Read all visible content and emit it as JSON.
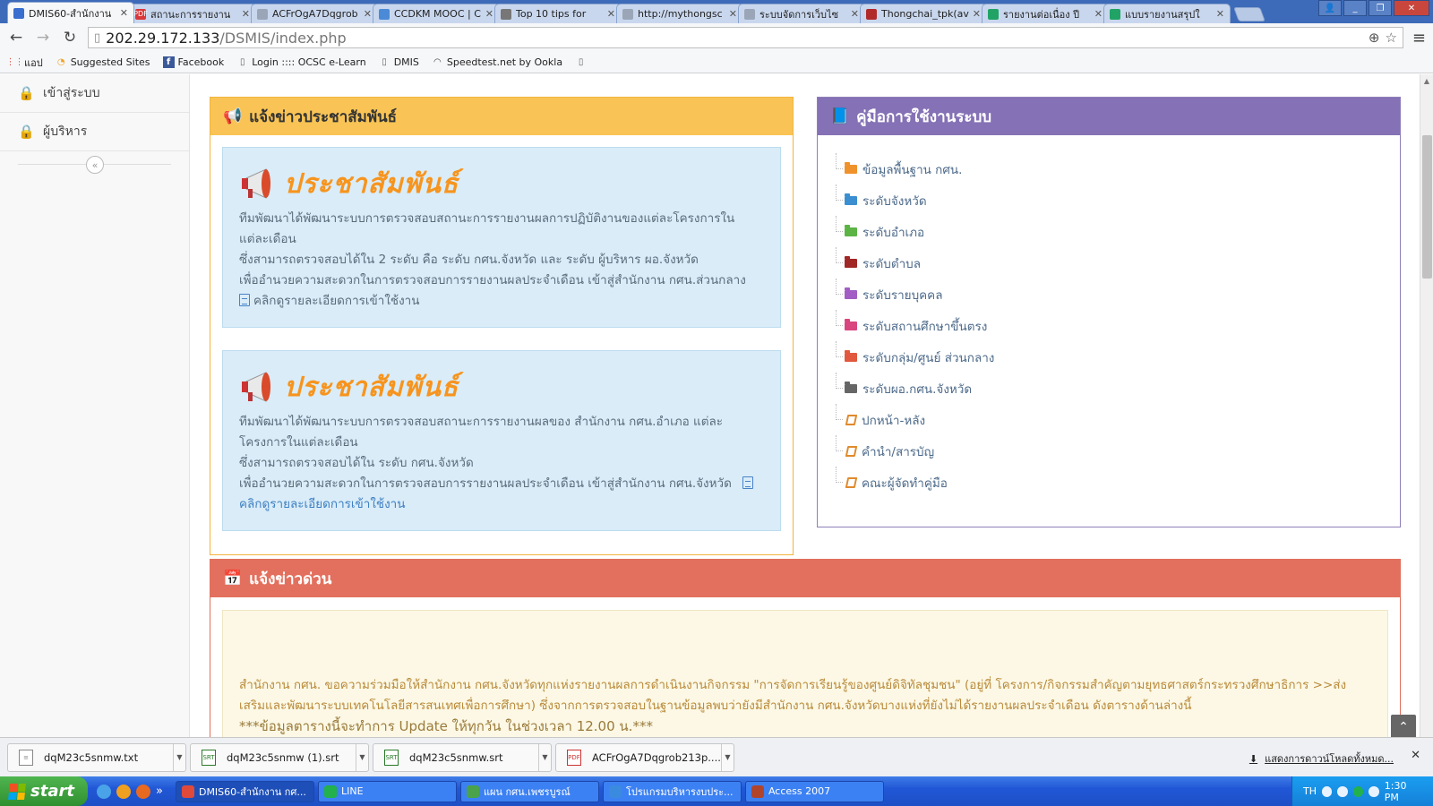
{
  "browser": {
    "tabs": [
      {
        "title": "DMIS60-สำนักงาน",
        "active": true,
        "favicon_color": "#3a6fcf"
      },
      {
        "title": "สถานะการรายงาน",
        "active": false,
        "favicon_color": "#d9383a",
        "favicon_text": "PDF"
      },
      {
        "title": "ACFrOgA7Dqgrob",
        "active": false,
        "favicon_color": "#9aa6b8"
      },
      {
        "title": "CCDKM MOOC | C",
        "active": false,
        "favicon_color": "#4b8ad6"
      },
      {
        "title": "Top 10 tips for",
        "active": false,
        "favicon_color": "#777777"
      },
      {
        "title": "http://mythongsc",
        "active": false,
        "favicon_color": "#9aa6b8"
      },
      {
        "title": "ระบบจัดการเว็บไซ",
        "active": false,
        "favicon_color": "#9aa6b8"
      },
      {
        "title": "Thongchai_tpk(av",
        "active": false,
        "favicon_color": "#b12a2a"
      },
      {
        "title": "รายงานต่อเนื่อง ปี",
        "active": false,
        "favicon_color": "#21a366"
      },
      {
        "title": "แบบรายงานสรุปใ",
        "active": false,
        "favicon_color": "#21a366"
      }
    ],
    "url_host": "202.29.172.133",
    "url_path": "/DSMIS/index.php",
    "bookmarks": [
      {
        "label": "แอป",
        "icon": "apps-icon"
      },
      {
        "label": "Suggested Sites",
        "icon": "suggested-sites-icon"
      },
      {
        "label": "Facebook",
        "icon": "facebook-icon"
      },
      {
        "label": "Login :::: OCSC e-Learn",
        "icon": "page-icon"
      },
      {
        "label": "DMIS",
        "icon": "page-icon"
      },
      {
        "label": "Speedtest.net by Ookla",
        "icon": "speedtest-icon"
      },
      {
        "label": "",
        "icon": "page-icon"
      }
    ]
  },
  "sidebar": {
    "items": [
      {
        "label": "เข้าสู่ระบบ",
        "icon": "lock-icon"
      },
      {
        "label": "ผู้บริหาร",
        "icon": "lock-icon"
      }
    ],
    "collapse_glyph": "«"
  },
  "pr_panel": {
    "title": "แจ้งข่าวประชาสัมพันธ์",
    "banner_text": "ประชาสัมพันธ์",
    "box1": {
      "line1": "ทีมพัฒนาได้พัฒนาระบบการตรวจสอบสถานะการรายงานผลการปฏิบัติงานของแต่ละโครงการใน",
      "line2": "แต่ละเดือน",
      "line3": "ซึ่งสามารถตรวจสอบได้ใน 2 ระดับ คือ ระดับ กศน.จังหวัด และ ระดับ ผู้บริหาร ผอ.จังหวัด",
      "line4": "เพื่ออำนวยความสะดวกในการตรวจสอบการรายงานผลประจำเดือน เข้าสู่สำนักงาน กศน.ส่วนกลาง",
      "link": "คลิกดูรายละเอียดการเข้าใช้งาน"
    },
    "box2": {
      "line1": "ทีมพัฒนาได้พัฒนาระบบการตรวจสอบสถานะการรายงานผลของ สำนักงาน กศน.อำเภอ แต่ละ",
      "line2": "โครงการในแต่ละเดือน",
      "line3": "ซึ่งสามารถตรวจสอบได้ใน ระดับ กศน.จังหวัด",
      "line4": "เพื่ออำนวยความสะดวกในการตรวจสอบการรายงานผลประจำเดือน เข้าสู่สำนักงาน กศน.จังหวัด",
      "link": "คลิกดูรายละเอียดการเข้าใช้งาน"
    }
  },
  "manual_panel": {
    "title": "คู่มือการใช้งานระบบ",
    "items": [
      {
        "label": "ข้อมูลพื้นฐาน กศน.",
        "icon": "folder-icon",
        "color": "#f0922b"
      },
      {
        "label": "ระดับจังหวัด",
        "icon": "folder-icon",
        "color": "#3b8fd0"
      },
      {
        "label": "ระดับอำเภอ",
        "icon": "folder-icon",
        "color": "#5cb445"
      },
      {
        "label": "ระดับตำบล",
        "icon": "folder-icon",
        "color": "#a12626"
      },
      {
        "label": "ระดับรายบุคคล",
        "icon": "folder-icon",
        "color": "#a25ec4"
      },
      {
        "label": "ระดับสถานศึกษาขึ้นตรง",
        "icon": "folder-icon",
        "color": "#d9457e"
      },
      {
        "label": "ระดับกลุ่ม/ศูนย์ ส่วนกลาง",
        "icon": "folder-icon",
        "color": "#e2583e"
      },
      {
        "label": "ระดับผอ.กศน.จังหวัด",
        "icon": "folder-icon",
        "color": "#666666"
      },
      {
        "label": "ปกหน้า-หลัง",
        "icon": "book-icon",
        "color": "#e08a2c"
      },
      {
        "label": "คำนำ/สารบัญ",
        "icon": "book-icon",
        "color": "#e08a2c"
      },
      {
        "label": "คณะผู้จัดทำคู่มือ",
        "icon": "book-icon",
        "color": "#e08a2c"
      }
    ]
  },
  "urgent_panel": {
    "title": "แจ้งข่าวด่วน",
    "line1": "สำนักงาน กศน. ขอความร่วมมือให้สำนักงาน กศน.จังหวัดทุกแห่งรายงานผลการดำเนินงานกิจกรรม \"การจัดการเรียนรู้ของศูนย์ดิจิทัลชุมชน\" (อยู่ที่ โครงการ/กิจกรรมสำคัญตามยุทธศาสตร์กระทรวงศึกษาธิการ >>ส่ง",
    "line2": "เสริมและพัฒนาระบบเทคโนโลยีสารสนเทศเพื่อการศึกษา) ซึ่งจากการตรวจสอบในฐานข้อมูลพบว่ายังมีสำนักงาน กศน.จังหวัดบางแห่งที่ยังไม่ได้รายงานผลประจำเดือน ดังตารางด้านล่างนี้",
    "note": "***ข้อมูลตารางนี้จะทำการ Update ให้ทุกวัน ในช่วงเวลา 12.00 น.***"
  },
  "downloads": {
    "items": [
      {
        "name": "dqM23c5snmw.txt",
        "type": "txt"
      },
      {
        "name": "dqM23c5snmw (1).srt",
        "type": "srt"
      },
      {
        "name": "dqM23c5snmw.srt",
        "type": "srt"
      },
      {
        "name": "ACFrOgA7Dqgrob213p....pdf",
        "type": "pdf"
      }
    ],
    "show_all": "แสดงการดาวน์โหลดทั้งหมด..."
  },
  "taskbar": {
    "start_label": "start",
    "tasks": [
      {
        "label": "DMIS60-สำนักงาน กศ...",
        "color": "#e04a3b",
        "active": true
      },
      {
        "label": "LINE",
        "color": "#22b14c",
        "active": false
      },
      {
        "label": "แผน กศน.เพชรบูรณ์",
        "color": "#4aa34a",
        "active": false
      },
      {
        "label": "โปรแกรมบริหารงบประ...",
        "color": "#3a8ae0",
        "active": false
      },
      {
        "label": "Access 2007",
        "color": "#b0452c",
        "active": false
      }
    ],
    "lang": "TH",
    "clock": "1:30 PM"
  }
}
